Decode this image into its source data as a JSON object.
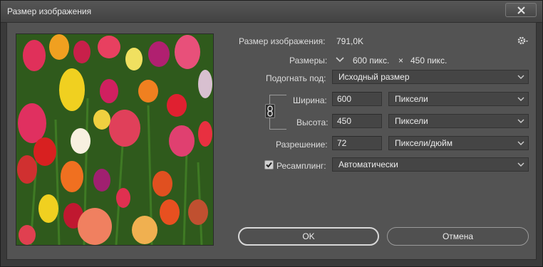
{
  "window": {
    "title": "Размер изображения"
  },
  "info": {
    "image_size_label": "Размер изображения:",
    "image_size_value": "791,0K",
    "dimensions_label": "Размеры:",
    "width_value": "600 пикс.",
    "times_sign": "×",
    "height_value": "450 пикс."
  },
  "fit": {
    "label": "Подогнать под:",
    "value": "Исходный размер"
  },
  "width": {
    "label": "Ширина:",
    "value": "600",
    "unit": "Пиксели"
  },
  "height": {
    "label": "Высота:",
    "value": "450",
    "unit": "Пиксели"
  },
  "resolution": {
    "label": "Разрешение:",
    "value": "72",
    "unit": "Пиксели/дюйм"
  },
  "resample": {
    "label": "Ресамплинг:",
    "checked": true,
    "value": "Автоматически"
  },
  "buttons": {
    "ok": "OK",
    "cancel": "Отмена"
  },
  "icons": [
    "close-icon",
    "gear-icon",
    "chevron-down-icon",
    "link-chain-icon",
    "checkmark-icon"
  ]
}
